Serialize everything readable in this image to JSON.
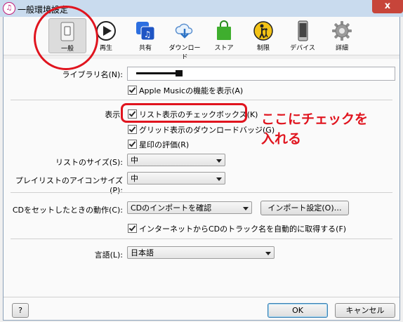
{
  "window": {
    "title": "一般環境設定",
    "close_glyph": "x"
  },
  "tabs": [
    {
      "label": "一般",
      "icon": "general-switch-icon",
      "active": true
    },
    {
      "label": "再生",
      "icon": "play-icon",
      "active": false
    },
    {
      "label": "共有",
      "icon": "sharing-music-icon",
      "active": false
    },
    {
      "label": "ダウンロード",
      "icon": "cloud-download-icon",
      "active": false
    },
    {
      "label": "ストア",
      "icon": "store-bag-icon",
      "active": false
    },
    {
      "label": "制限",
      "icon": "parental-restriction-icon",
      "active": false
    },
    {
      "label": "デバイス",
      "icon": "device-phone-icon",
      "active": false
    },
    {
      "label": "詳細",
      "icon": "advanced-gear-icon",
      "active": false
    }
  ],
  "library": {
    "label": "ライブラリ名(N):",
    "value": "",
    "apple_music": "Apple Musicの機能を表示(A)"
  },
  "display": {
    "label": "表示:",
    "list_checkboxes": "リスト表示のチェックボックス(K)",
    "grid_download_badge": "グリッド表示のダウンロードバッジ(G)",
    "star_rating": "星印の評価(R)"
  },
  "list_size": {
    "label": "リストのサイズ(S):",
    "value": "中"
  },
  "playlist_icon_size": {
    "label": "プレイリストのアイコンサイズ(P):",
    "value": "中"
  },
  "cd_insert": {
    "label": "CDをセットしたときの動作(C):",
    "value": "CDのインポートを確認",
    "import_settings_button": "インポート設定(O)…",
    "auto_track_names": "インターネットからCDのトラック名を自動的に取得する(F)"
  },
  "language": {
    "label": "言語(L):",
    "value": "日本語"
  },
  "footer": {
    "help": "?",
    "ok": "OK",
    "cancel": "キャンセル"
  },
  "annotation": {
    "line1": "ここにチェックを",
    "line2": "入れる"
  },
  "colors": {
    "annotation_red": "#e0141e",
    "titlebar": "#c9dbee",
    "close_red": "#c7453a"
  }
}
